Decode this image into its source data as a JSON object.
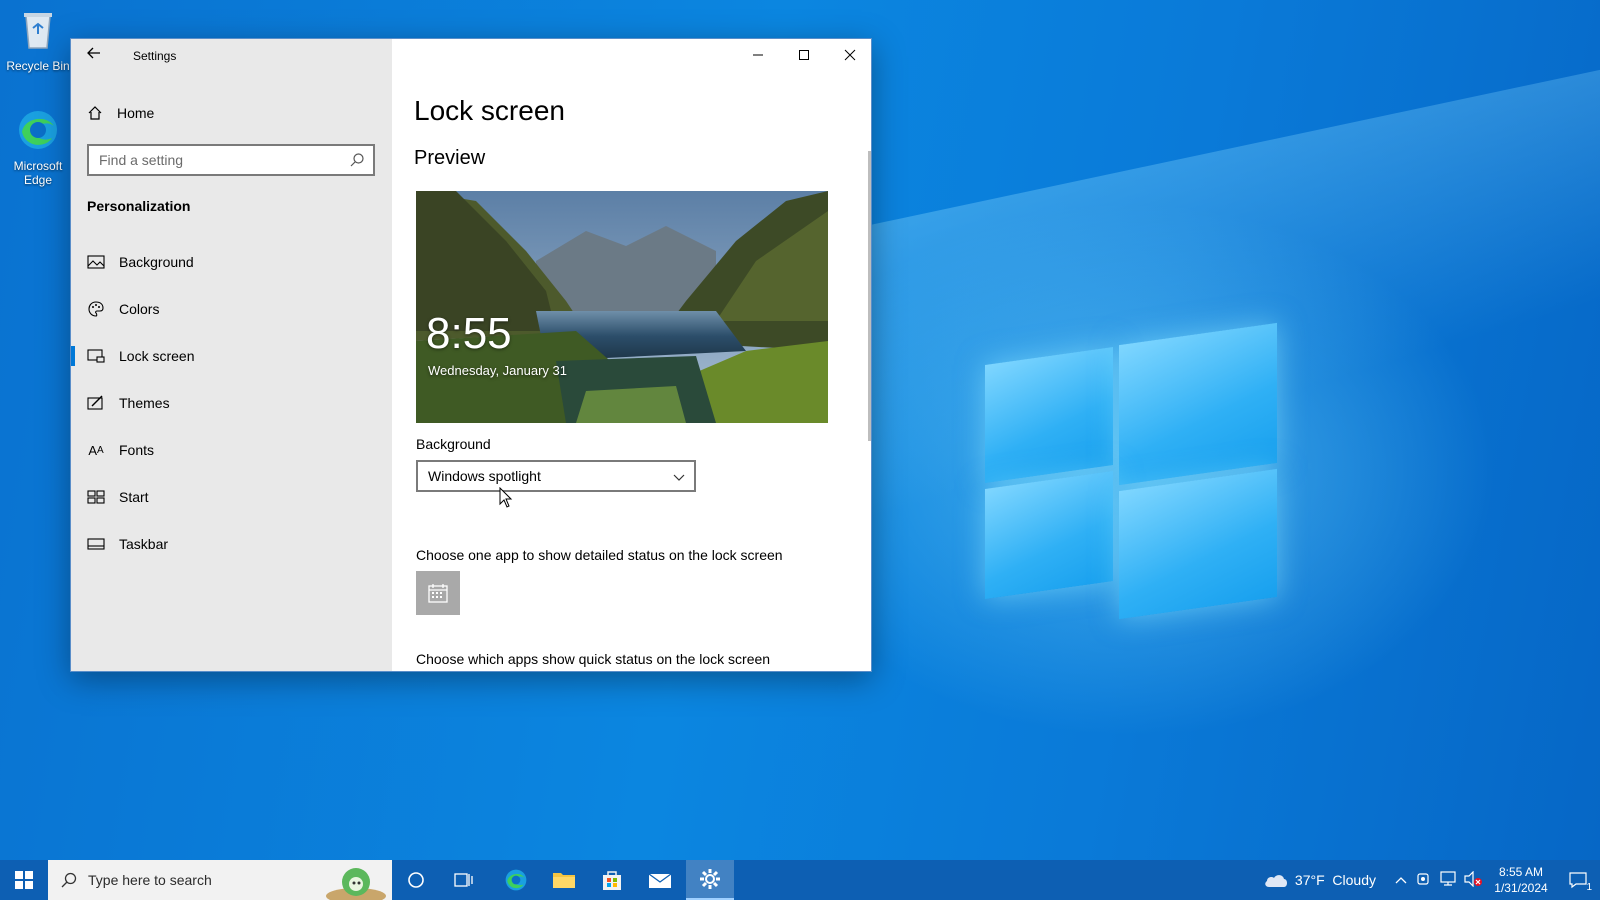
{
  "desktop": {
    "icons": [
      {
        "label": "Recycle Bin"
      },
      {
        "label": "Microsoft\nEdge",
        "line1": "Microsoft",
        "line2": "Edge"
      }
    ]
  },
  "window": {
    "title": "Settings",
    "home_label": "Home",
    "search_placeholder": "Find a setting",
    "section_heading": "Personalization",
    "nav_items": [
      {
        "label": "Background",
        "icon": "picture-icon"
      },
      {
        "label": "Colors",
        "icon": "palette-icon"
      },
      {
        "label": "Lock screen",
        "icon": "lock-screen-icon",
        "active": true
      },
      {
        "label": "Themes",
        "icon": "themes-icon"
      },
      {
        "label": "Fonts",
        "icon": "fonts-icon"
      },
      {
        "label": "Start",
        "icon": "start-icon"
      },
      {
        "label": "Taskbar",
        "icon": "taskbar-icon"
      }
    ],
    "page_title": "Lock screen",
    "preview_heading": "Preview",
    "preview_time": "8:55",
    "preview_date": "Wednesday, January 31",
    "background_label": "Background",
    "background_value": "Windows spotlight",
    "detailed_status_label": "Choose one app to show detailed status on the lock screen",
    "detailed_status_app_icon": "calendar-icon",
    "quick_status_label": "Choose which apps show quick status on the lock screen"
  },
  "taskbar": {
    "search_placeholder": "Type here to search",
    "weather": "37°F  Cloudy",
    "time": "8:55 AM",
    "date": "1/31/2024",
    "notification_count": "1"
  },
  "colors": {
    "accent": "#0078d7",
    "taskbar": "#0d5fb3",
    "nav_bg": "#e9e9e9"
  }
}
